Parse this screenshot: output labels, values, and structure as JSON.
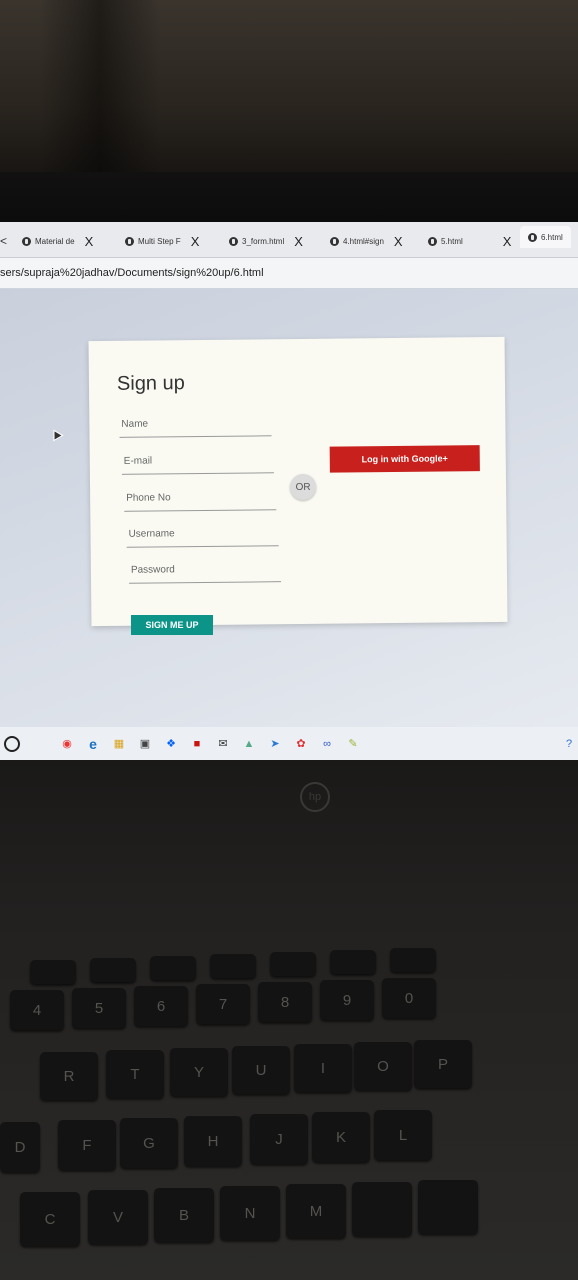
{
  "browser": {
    "tabs": [
      {
        "title": "Material de",
        "icon": "site-icon"
      },
      {
        "title": "Multi Step F",
        "icon": "site-icon"
      },
      {
        "title": "3_form.html",
        "icon": "globe-icon"
      },
      {
        "title": "4.html#sign",
        "icon": "globe-icon"
      },
      {
        "title": "5.html",
        "icon": "globe-icon"
      },
      {
        "title": "6.html",
        "icon": "globe-icon"
      }
    ],
    "close_glyph": "X",
    "address": "sers/supraja%20jadhav/Documents/sign%20up/6.html"
  },
  "form": {
    "title": "Sign up",
    "fields": {
      "name": "Name",
      "email": "E-mail",
      "phone": "Phone No",
      "username": "Username",
      "password": "Password"
    },
    "or_label": "OR",
    "google_button": "Log in with Google+",
    "submit_button": "SIGN ME UP",
    "colors": {
      "google": "#c8201c",
      "submit": "#0d9488"
    }
  },
  "keyboard": {
    "row_numbers": [
      "4",
      "5",
      "6",
      "7",
      "8",
      "9",
      "0"
    ],
    "row_numbers_shift": [
      "$",
      "%",
      "",
      "&",
      "",
      "(",
      ")"
    ],
    "row_top": [
      "R",
      "T",
      "Y",
      "U",
      "I",
      "O",
      "P"
    ],
    "row_home": [
      "D",
      "F",
      "G",
      "H",
      "J",
      "K",
      "L"
    ],
    "row_bottom": [
      "C",
      "V",
      "B",
      "N",
      "M"
    ],
    "brand": "hp"
  }
}
